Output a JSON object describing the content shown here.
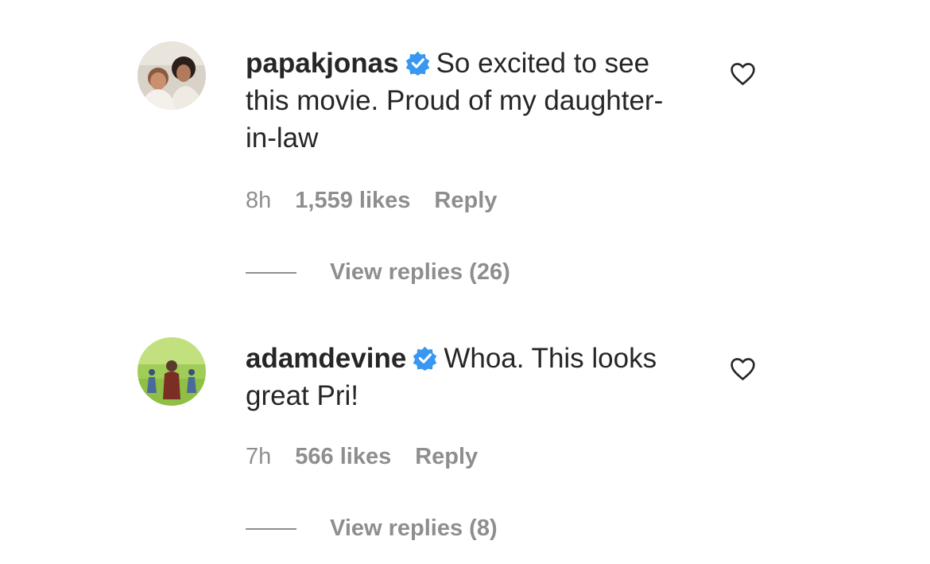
{
  "comments": [
    {
      "username": "papakjonas",
      "verified": true,
      "text": "So excited to see this movie. Proud of my daughter-in-law",
      "time": "8h",
      "likes": "1,559 likes",
      "reply_label": "Reply",
      "view_replies": "View replies (26)"
    },
    {
      "username": "adamdevine",
      "verified": true,
      "text": "Whoa. This looks great Pri!",
      "time": "7h",
      "likes": "566 likes",
      "reply_label": "Reply",
      "view_replies": "View replies (8)"
    }
  ],
  "icons": {
    "verified": "verified-badge-icon",
    "like": "heart-outline-icon"
  },
  "colors": {
    "text": "#262626",
    "secondary": "#8e8e8e",
    "verified": "#3897f0"
  }
}
